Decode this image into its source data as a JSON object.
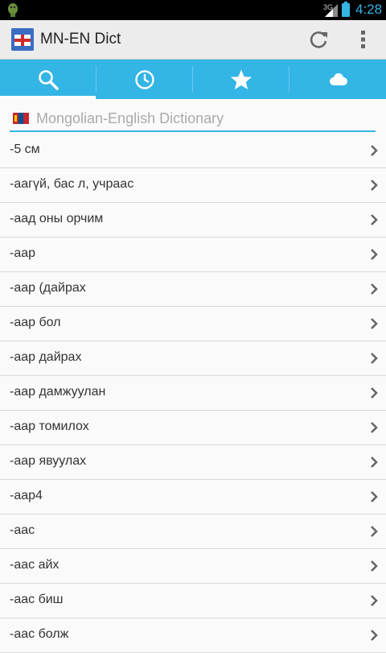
{
  "status_bar": {
    "network": "3G",
    "time": "4:28"
  },
  "action_bar": {
    "title": "MN-EN Dict",
    "logo_icon": "gb-flag-app-logo",
    "actions": [
      "refresh-icon",
      "overflow-menu-icon"
    ]
  },
  "tabs": [
    {
      "icon": "search-icon",
      "selected": true
    },
    {
      "icon": "history-clock-icon",
      "selected": false
    },
    {
      "icon": "star-icon",
      "selected": false
    },
    {
      "icon": "cloud-icon",
      "selected": false
    }
  ],
  "search": {
    "placeholder": "Mongolian-English Dictionary",
    "value": "",
    "flag_icon": "mongolia-flag-icon"
  },
  "entries": [
    "-5 см",
    "-аагүй, бас л, учраас",
    "-аад оны орчим",
    "-аар",
    "-аар (дайрах",
    "-аар бол",
    "-аар дайрах",
    "-аар дамжуулан",
    "-аар томилох",
    "-аар явуулах",
    "-аар4",
    "-аас",
    "-аас айх",
    "-аас биш",
    "-аас болж"
  ],
  "colors": {
    "accent": "#33b5e5",
    "action_bar": "#ececec",
    "status_bar": "#000000"
  }
}
